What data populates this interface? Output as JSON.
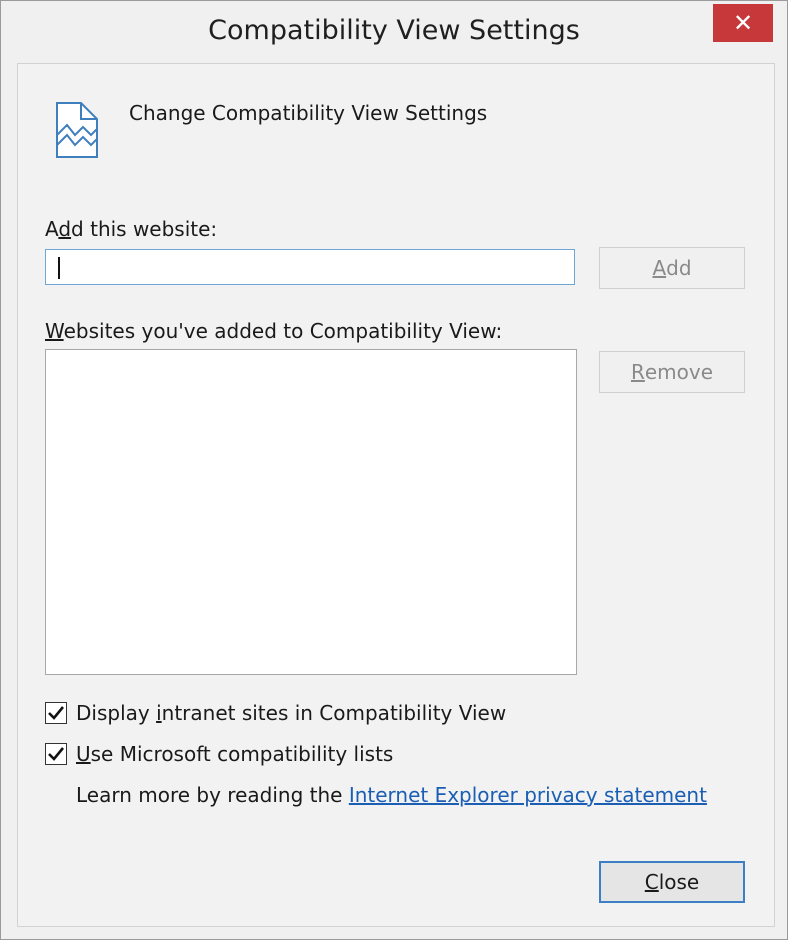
{
  "window": {
    "title": "Compatibility View Settings",
    "close_glyph": "✕"
  },
  "header": {
    "icon": "broken-page-icon",
    "text": "Change Compatibility View Settings"
  },
  "add_section": {
    "label_pre": "A",
    "label_accel": "d",
    "label_post": "d this website:",
    "input_value": "",
    "add_button_accel": "A",
    "add_button_rest": "dd"
  },
  "list_section": {
    "label_accel": "W",
    "label_rest": "ebsites you've added to Compatibility View:",
    "items": [],
    "remove_button_accel": "R",
    "remove_button_rest": "emove"
  },
  "options": {
    "intranet": {
      "checked": true,
      "pre": "Display ",
      "accel": "i",
      "post": "ntranet sites in Compatibility View"
    },
    "ms_lists": {
      "checked": true,
      "accel": "U",
      "post": "se Microsoft compatibility lists"
    }
  },
  "learn_more": {
    "text": "Learn more by reading the ",
    "link_text": "Internet Explorer privacy statement"
  },
  "footer": {
    "close_accel": "C",
    "close_rest": "lose"
  },
  "colors": {
    "accent": "#3c7fc5",
    "link": "#1a5fb4",
    "close_x_bg": "#c7383b"
  }
}
